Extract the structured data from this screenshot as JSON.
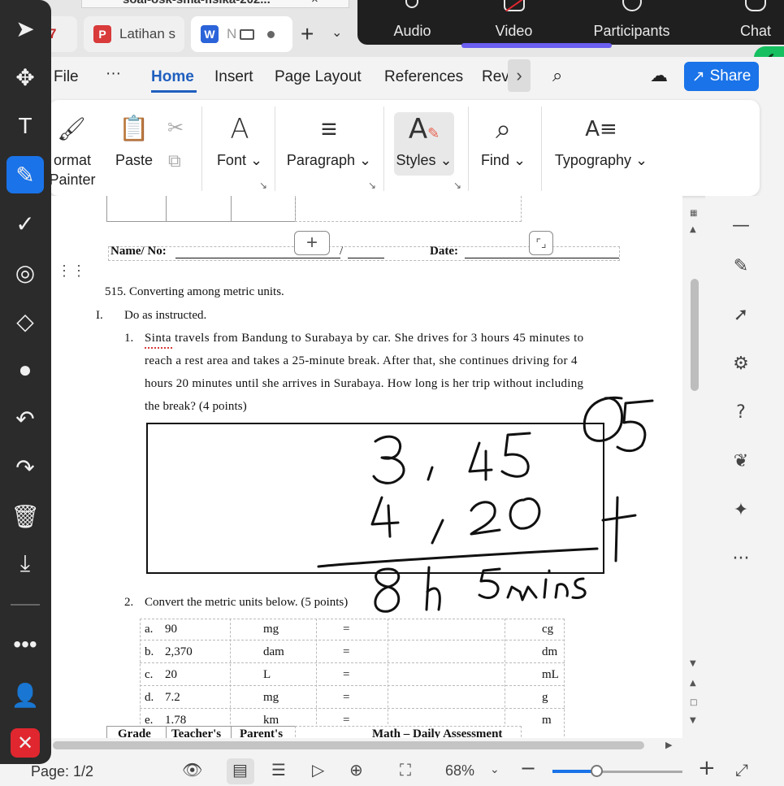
{
  "browser": {
    "top_tab_title": "soal-osk-sma-fisika-202...",
    "tab_pdf_label": "Latihan s",
    "tab_word_label": "N",
    "tab_number_partial": "7",
    "tab_close": "×"
  },
  "zoom_meeting": {
    "items": [
      "Audio",
      "Video",
      "Participants",
      "Chat"
    ]
  },
  "menu": {
    "file": "File",
    "dots": "···",
    "tabs": [
      "Home",
      "Insert",
      "Page Layout",
      "References",
      "Rev"
    ],
    "share": "Share"
  },
  "ribbon": {
    "format_painter_line1": "ormat",
    "format_painter_line2": "Painter",
    "paste": "Paste",
    "font": "Font",
    "paragraph": "Paragraph",
    "styles": "Styles",
    "find": "Find",
    "typography": "Typography"
  },
  "document": {
    "name_label": "Name/ No:",
    "name_slash": "/",
    "date_label": "Date:",
    "heading": "515. Converting among metric units.",
    "section_roman": "I.",
    "section_title": "Do as instructed.",
    "q1_number": "1.",
    "q1_lines": [
      "Sinta travels from Bandung to Surabaya by car. She drives for 3 hours 45 minutes to",
      "reach a rest area and takes a 25-minute break. After that, she continues driving for 4",
      "hours 20 minutes until she arrives in Surabaya. How long is her trip without including",
      "the break? (4 points)"
    ],
    "q2_number": "2.",
    "q2_text": "Convert the metric units below. (5 points)",
    "conversions": [
      {
        "letter": "a.",
        "value": "90",
        "from": "mg",
        "eq": "=",
        "to": "cg"
      },
      {
        "letter": "b.",
        "value": "2,370",
        "from": "dam",
        "eq": "=",
        "to": "dm"
      },
      {
        "letter": "c.",
        "value": "20",
        "from": "L",
        "eq": "=",
        "to": "mL"
      },
      {
        "letter": "d.",
        "value": "7.2",
        "from": "mg",
        "eq": "=",
        "to": "g"
      },
      {
        "letter": "e.",
        "value": "1.78",
        "from": "km",
        "eq": "=",
        "to": "m"
      }
    ],
    "footer_headers": [
      "Grade",
      "Teacher's",
      "Parent's",
      "Math – Daily Assessment"
    ]
  },
  "handwriting": [
    "05",
    "3 , 45",
    "4 , 20",
    "+",
    "8h 5mins"
  ],
  "status": {
    "page": "Page: 1/2",
    "zoom": "68%"
  },
  "colors": {
    "accent": "#1a73e8",
    "close_red": "#e0272f",
    "zoom_purple": "#6a5ff0",
    "live_green": "#16c060"
  }
}
